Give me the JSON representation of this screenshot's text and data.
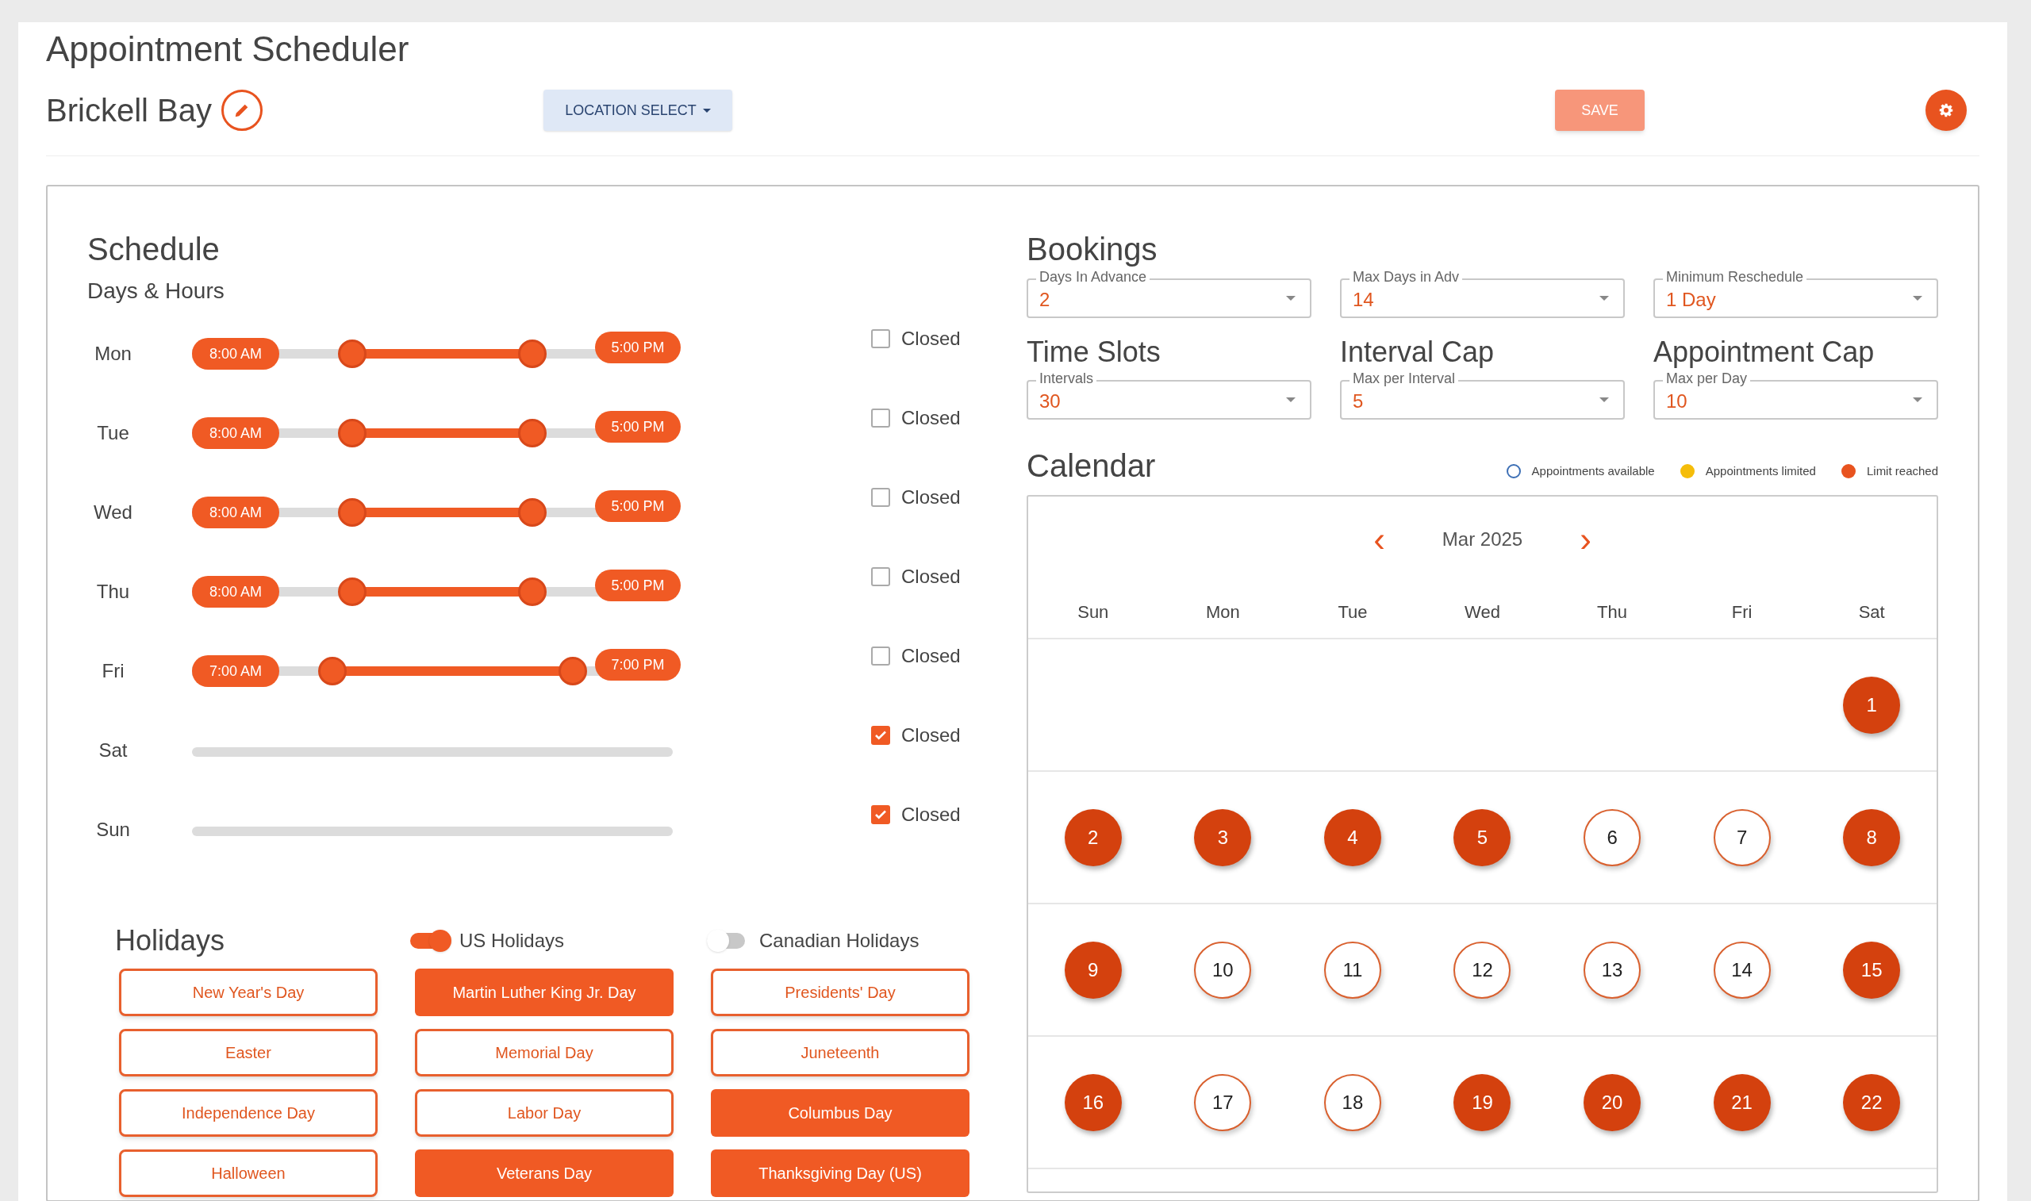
{
  "header": {
    "title": "Appointment Scheduler",
    "location_name": "Brickell Bay",
    "location_select": "LOCATION SELECT",
    "save": "SAVE"
  },
  "schedule": {
    "title": "Schedule",
    "subtitle": "Days & Hours",
    "days": [
      {
        "day": "Mon",
        "closed": false,
        "closed_label": "Closed",
        "open_time": "8:00 AM",
        "close_time": "5:00 PM",
        "start_thumb": {
          "level": 0.333
        },
        "end_thumb": {
          "level": 0.708
        }
      },
      {
        "day": "Tue",
        "closed": false,
        "closed_label": "Closed",
        "open_time": "8:00 AM",
        "close_time": "5:00 PM",
        "start_thumb": {
          "level": 0.333
        },
        "end_thumb": {
          "level": 0.708
        }
      },
      {
        "day": "Wed",
        "closed": false,
        "closed_label": "Closed",
        "open_time": "8:00 AM",
        "close_time": "5:00 PM",
        "start_thumb": {
          "level": 0.333
        },
        "end_thumb": {
          "level": 0.708
        }
      },
      {
        "day": "Thu",
        "closed": false,
        "closed_label": "Closed",
        "open_time": "8:00 AM",
        "close_time": "5:00 PM",
        "start_thumb": {
          "level": 0.333
        },
        "end_thumb": {
          "level": 0.708
        }
      },
      {
        "day": "Fri",
        "closed": false,
        "closed_label": "Closed",
        "open_time": "7:00 AM",
        "close_time": "7:00 PM",
        "start_thumb": {
          "level": 0.292
        },
        "end_thumb": {
          "level": 0.792
        }
      },
      {
        "day": "Sat",
        "closed": true,
        "closed_label": "Closed"
      },
      {
        "day": "Sun",
        "closed": true,
        "closed_label": "Closed"
      }
    ]
  },
  "holidays": {
    "title": "Holidays",
    "toggles": [
      {
        "label": "US Holidays",
        "on": true
      },
      {
        "label": "Canadian Holidays",
        "on": false
      }
    ],
    "items": [
      {
        "label": "New Year's Day",
        "selected": false
      },
      {
        "label": "Martin Luther King Jr. Day",
        "selected": true
      },
      {
        "label": "Presidents' Day",
        "selected": false
      },
      {
        "label": "Easter",
        "selected": false
      },
      {
        "label": "Memorial Day",
        "selected": false
      },
      {
        "label": "Juneteenth",
        "selected": false
      },
      {
        "label": "Independence Day",
        "selected": false
      },
      {
        "label": "Labor Day",
        "selected": false
      },
      {
        "label": "Columbus Day",
        "selected": true
      },
      {
        "label": "Halloween",
        "selected": false
      },
      {
        "label": "Veterans Day",
        "selected": true
      },
      {
        "label": "Thanksgiving Day (US)",
        "selected": true
      }
    ]
  },
  "bookings": {
    "title": "Bookings",
    "fields": [
      {
        "label": "Days In Advance",
        "value": "2"
      },
      {
        "label": "Max Days in Adv",
        "value": "14"
      },
      {
        "label": "Minimum Reschedule",
        "value": "1 Day"
      }
    ]
  },
  "caps": [
    {
      "title": "Time Slots",
      "field": {
        "label": "Intervals",
        "value": "30"
      }
    },
    {
      "title": "Interval Cap",
      "field": {
        "label": "Max per Interval",
        "value": "5"
      }
    },
    {
      "title": "Appointment Cap",
      "field": {
        "label": "Max per Day",
        "value": "10"
      }
    }
  ],
  "calendar": {
    "title": "Calendar",
    "legend": [
      {
        "label": "Appointments available",
        "kind": "ring",
        "color": "#3d6fb5"
      },
      {
        "label": "Appointments limited",
        "kind": "dot",
        "color": "#f5bd0a"
      },
      {
        "label": "Limit reached",
        "kind": "dot",
        "color": "#e8531f"
      }
    ],
    "prev": "‹",
    "month": "Mar 2025",
    "next": "›",
    "weekdays": [
      "Sun",
      "Mon",
      "Tue",
      "Wed",
      "Thu",
      "Fri",
      "Sat"
    ],
    "weeks": [
      [
        {
          "kind": "empty"
        },
        {
          "kind": "empty"
        },
        {
          "kind": "empty"
        },
        {
          "kind": "empty"
        },
        {
          "kind": "empty"
        },
        {
          "kind": "empty"
        },
        {
          "label": "1",
          "kind": "limit"
        }
      ],
      [
        {
          "label": "2",
          "kind": "limit"
        },
        {
          "label": "3",
          "kind": "limit"
        },
        {
          "label": "4",
          "kind": "limit"
        },
        {
          "label": "5",
          "kind": "limit"
        },
        {
          "label": "6",
          "kind": "available"
        },
        {
          "label": "7",
          "kind": "available"
        },
        {
          "label": "8",
          "kind": "limit"
        }
      ],
      [
        {
          "label": "9",
          "kind": "limit"
        },
        {
          "label": "10",
          "kind": "available"
        },
        {
          "label": "11",
          "kind": "available"
        },
        {
          "label": "12",
          "kind": "available"
        },
        {
          "label": "13",
          "kind": "available"
        },
        {
          "label": "14",
          "kind": "available"
        },
        {
          "label": "15",
          "kind": "limit"
        }
      ],
      [
        {
          "label": "16",
          "kind": "limit"
        },
        {
          "label": "17",
          "kind": "available"
        },
        {
          "label": "18",
          "kind": "available"
        },
        {
          "label": "19",
          "kind": "limit"
        },
        {
          "label": "20",
          "kind": "limit"
        },
        {
          "label": "21",
          "kind": "limit"
        },
        {
          "label": "22",
          "kind": "limit"
        }
      ]
    ]
  }
}
